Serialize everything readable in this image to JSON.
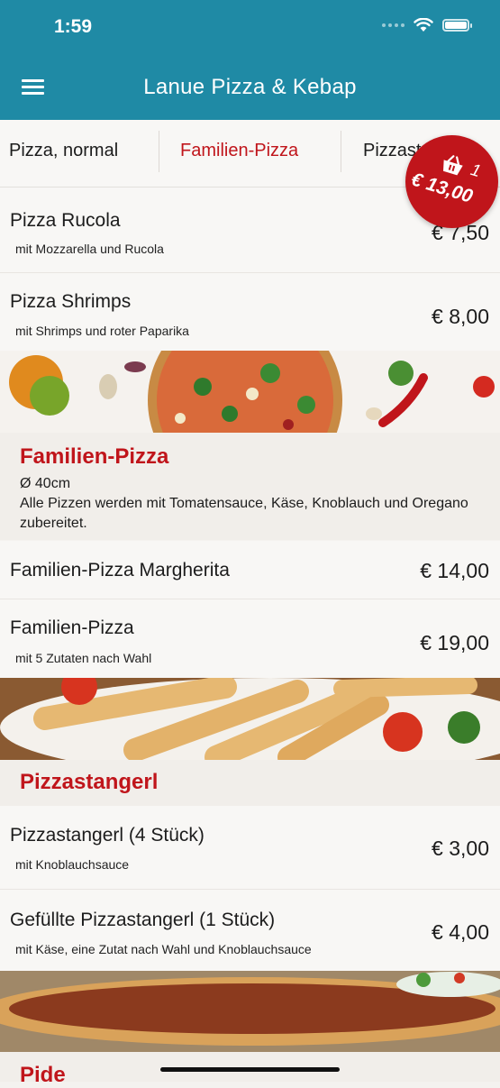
{
  "status": {
    "time": "1:59"
  },
  "header": {
    "title": "Lanue Pizza & Kebap"
  },
  "tabs": [
    {
      "label": "Pizza, normal",
      "active": false
    },
    {
      "label": "Familien-Pizza",
      "active": true
    },
    {
      "label": "Pizzastangerl",
      "active": false
    }
  ],
  "cart": {
    "count": "1",
    "total": "€ 13,00"
  },
  "items": [
    {
      "name": "Pizza Rucola",
      "desc": "mit Mozzarella und Rucola",
      "price": "€ 7,50"
    },
    {
      "name": "Pizza Shrimps",
      "desc": "mit Shrimps und roter Paparika",
      "price": "€ 8,00"
    },
    {
      "name": "Familien-Pizza Margherita",
      "desc": "",
      "price": "€ 14,00"
    },
    {
      "name": "Familien-Pizza",
      "desc": "mit 5 Zutaten nach Wahl",
      "price": "€ 19,00"
    },
    {
      "name": "Pizzastangerl (4 Stück)",
      "desc": "mit Knoblauchsauce",
      "price": "€ 3,00"
    },
    {
      "name": "Gefüllte Pizzastangerl (1 Stück)",
      "desc": "mit Käse, eine Zutat nach Wahl und Knoblauchsauce",
      "price": "€ 4,00"
    }
  ],
  "sections": [
    {
      "title": "Familien-Pizza",
      "size": "Ø 40cm",
      "desc": "Alle Pizzen werden mit Tomatensauce, Käse, Knoblauch und Oregano zubereitet."
    },
    {
      "title": "Pizzastangerl"
    },
    {
      "title": "Pide"
    }
  ],
  "colors": {
    "header": "#1f8aa5",
    "accent": "#c0151b",
    "background": "#f8f7f5"
  },
  "icons": {
    "menu": "hamburger-menu-icon",
    "cart": "shopping-basket-icon",
    "wifi": "wifi-icon",
    "battery": "battery-icon"
  }
}
